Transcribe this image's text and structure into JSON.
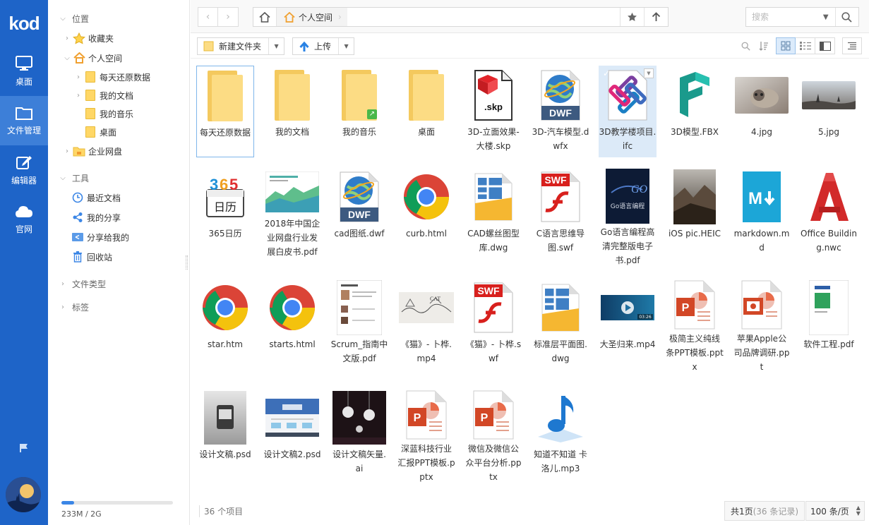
{
  "app": {
    "logo": "kod"
  },
  "rail": [
    {
      "label": "桌面",
      "icon": "monitor-icon"
    },
    {
      "label": "文件管理",
      "icon": "folder-icon",
      "active": true
    },
    {
      "label": "编辑器",
      "icon": "edit-icon"
    },
    {
      "label": "官网",
      "icon": "cloud-icon"
    }
  ],
  "tree": {
    "location": "位置",
    "favorites": "收藏夹",
    "personal": "个人空间",
    "sub": [
      "每天还原数据",
      "我的文档",
      "我的音乐",
      "桌面"
    ],
    "enterprise": "企业网盘",
    "tools": "工具",
    "recent": "最近文档",
    "myshare": "我的分享",
    "sharedwithme": "分享给我的",
    "recycle": "回收站",
    "filetypes": "文件类型",
    "tags": "标签"
  },
  "quota": {
    "text": "233M / 2G",
    "used_fraction": 0.114
  },
  "address": {
    "crumb": "个人空间"
  },
  "search": {
    "placeholder": "搜索"
  },
  "toolbar": {
    "new_folder": "新建文件夹",
    "upload": "上传"
  },
  "status": {
    "count": "36 个项目",
    "page": "共1页",
    "records": "(36 条记录)",
    "per_page": "100 条/页"
  },
  "files": [
    {
      "name": "每天还原数据",
      "type": "folder"
    },
    {
      "name": "我的文档",
      "type": "folder"
    },
    {
      "name": "我的音乐",
      "type": "folder-shared"
    },
    {
      "name": "桌面",
      "type": "folder"
    },
    {
      "name": "3D-立面效果-大楼.skp",
      "type": "skp"
    },
    {
      "name": "3D-汽车模型.dwfx",
      "type": "dwf"
    },
    {
      "name": "3D教学楼项目.ifc",
      "type": "ifc"
    },
    {
      "name": "3D模型.FBX",
      "type": "fbx"
    },
    {
      "name": "4.jpg",
      "type": "photo-cat"
    },
    {
      "name": "5.jpg",
      "type": "photo-sky"
    },
    {
      "name": "365日历",
      "type": "calendar"
    },
    {
      "name": "2018年中国企业网盘行业发展白皮书.pdf",
      "type": "pdf-green"
    },
    {
      "name": "cad图纸.dwf",
      "type": "dwf"
    },
    {
      "name": "curb.html",
      "type": "chrome"
    },
    {
      "name": "CAD螺丝图型库.dwg",
      "type": "dwg"
    },
    {
      "name": "C语言思维导图.swf",
      "type": "swf"
    },
    {
      "name": "Go语言编程高清完整版电子书.pdf",
      "type": "pdf-go"
    },
    {
      "name": "iOS pic.HEIC",
      "type": "photo-heic"
    },
    {
      "name": "markdown.md",
      "type": "md"
    },
    {
      "name": "Office Building.nwc",
      "type": "autocad"
    },
    {
      "name": "star.htm",
      "type": "chrome"
    },
    {
      "name": "starts.html",
      "type": "chrome"
    },
    {
      "name": "Scrum_指南中文版.pdf",
      "type": "pdf-doc"
    },
    {
      "name": "《猫》- 卜桦.mp4",
      "type": "video-sketch"
    },
    {
      "name": "《猫》- 卜桦.swf",
      "type": "swf"
    },
    {
      "name": "标准层平面图.dwg",
      "type": "dwg"
    },
    {
      "name": "大圣归来.mp4",
      "type": "video"
    },
    {
      "name": "极简主义纯线条PPT模板.pptx",
      "type": "ppt"
    },
    {
      "name": "苹果Apple公司品牌调研.ppt",
      "type": "ppt-old"
    },
    {
      "name": "软件工程.pdf",
      "type": "pdf-green2"
    },
    {
      "name": "设计文稿.psd",
      "type": "psd-gray"
    },
    {
      "name": "设计文稿2.psd",
      "type": "psd-web"
    },
    {
      "name": "设计文稿矢量.ai",
      "type": "ai-dark"
    },
    {
      "name": "深蓝科技行业汇报PPT模板.pptx",
      "type": "ppt"
    },
    {
      "name": "微信及微信公众平台分析.pptx",
      "type": "ppt"
    },
    {
      "name": "知道不知道 卡洛儿.mp3",
      "type": "music"
    }
  ],
  "colors": {
    "rail": "#1e64c8",
    "rail_active": "#3d7fd8",
    "accent": "#3b86e6",
    "folder": "#fcdc84"
  }
}
